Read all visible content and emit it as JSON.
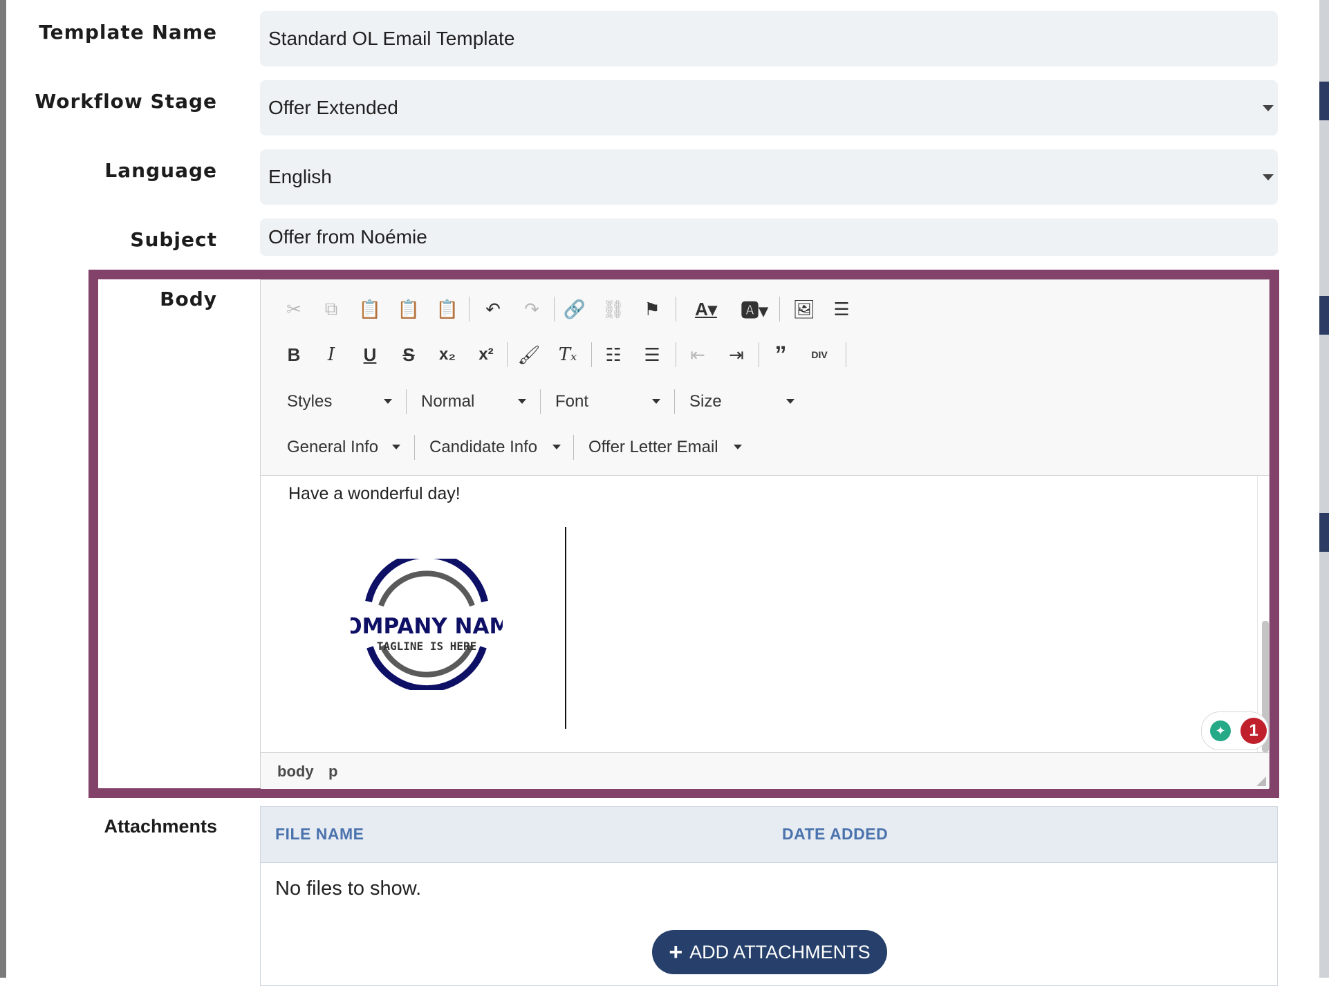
{
  "form": {
    "template_name": {
      "label": "Template Name",
      "value": "Standard OL Email Template"
    },
    "workflow_stage": {
      "label": "Workflow Stage",
      "value": "Offer Extended"
    },
    "language": {
      "label": "Language",
      "value": "English"
    },
    "subject": {
      "label": "Subject",
      "value": "Offer from Noémie"
    },
    "body_label": "Body",
    "attachments_label": "Attachments"
  },
  "editor": {
    "toolbar_row1": [
      "cut-icon",
      "copy-icon",
      "paste-icon",
      "paste-text-icon",
      "paste-word-icon",
      "undo-icon",
      "redo-icon",
      "link-icon",
      "unlink-icon",
      "anchor-flag-icon",
      "text-color-icon",
      "background-color-icon",
      "image-icon",
      "horizontal-line-icon"
    ],
    "toolbar_row2": [
      "bold-icon",
      "italic-icon",
      "underline-icon",
      "strikethrough-icon",
      "subscript-icon",
      "superscript-icon",
      "copy-format-icon",
      "remove-format-icon",
      "numbered-list-icon",
      "bulleted-list-icon",
      "decrease-indent-icon",
      "increase-indent-icon",
      "blockquote-icon",
      "create-div-icon"
    ],
    "combos_row3": {
      "styles": "Styles",
      "format": "Normal",
      "font": "Font",
      "size": "Size"
    },
    "combos_row4": {
      "general_info": "General Info",
      "candidate_info": "Candidate Info",
      "offer_letter_email": "Offer Letter Email"
    },
    "content": {
      "greeting": "Have a wonderful day!",
      "logo_name": "COMPANY NAME",
      "logo_tagline": "TAGLINE IS HERE"
    },
    "grammar_badge_count": "1",
    "path": {
      "body": "body",
      "p": "p"
    }
  },
  "attachments": {
    "col_file_name": "FILE NAME",
    "col_date_added": "DATE ADDED",
    "empty_text": "No files to show.",
    "add_button": "ADD ATTACHMENTS"
  },
  "colors": {
    "body_highlight": "#82426a",
    "button": "#27406b",
    "header_text": "#4a72ad"
  }
}
